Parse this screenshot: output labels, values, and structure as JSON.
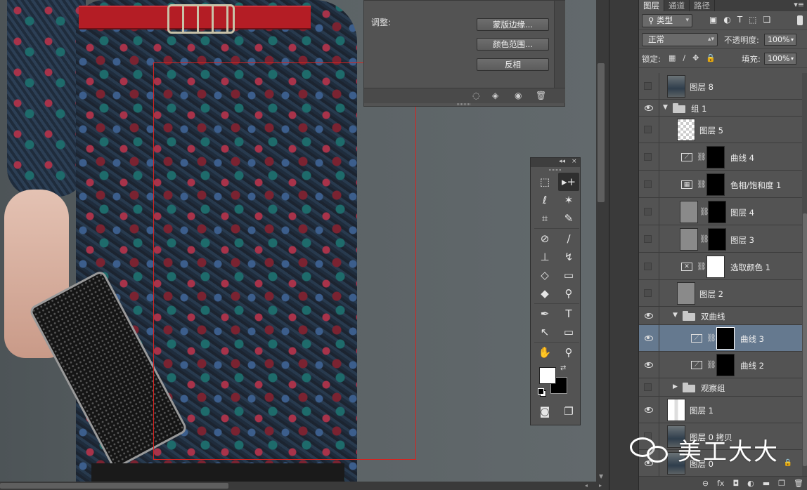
{
  "adjustments": {
    "section_label": "调整:",
    "buttons": [
      "蒙版边缘...",
      "颜色范围...",
      "反相"
    ],
    "footer_icons": [
      "◌",
      "◈",
      "◉",
      "🗑"
    ]
  },
  "layers_panel": {
    "tabs": [
      "图层",
      "通道",
      "路径"
    ],
    "filter_kind": "类型",
    "blend_mode": "正常",
    "opacity_label": "不透明度:",
    "opacity_value": "100%",
    "lock_label": "锁定:",
    "fill_label": "填充:",
    "fill_value": "100%",
    "layers": [
      {
        "name": "图层 8",
        "visible": false,
        "indent": 0,
        "kind": "photo"
      },
      {
        "name": "组 1",
        "visible": true,
        "indent": 0,
        "kind": "group",
        "expanded": true
      },
      {
        "name": "图层 5",
        "visible": false,
        "indent": 1,
        "kind": "transparent"
      },
      {
        "name": "曲线 4",
        "visible": false,
        "indent": 1,
        "kind": "curves"
      },
      {
        "name": "色相/饱和度 1",
        "visible": false,
        "indent": 1,
        "kind": "huesat"
      },
      {
        "name": "图层 4",
        "visible": false,
        "indent": 1,
        "kind": "masked-gray"
      },
      {
        "name": "图层 3",
        "visible": false,
        "indent": 1,
        "kind": "masked-gray"
      },
      {
        "name": "选取颜色 1",
        "visible": false,
        "indent": 1,
        "kind": "selective"
      },
      {
        "name": "图层 2",
        "visible": false,
        "indent": 1,
        "kind": "gray"
      },
      {
        "name": "双曲线",
        "visible": true,
        "indent": 1,
        "kind": "group",
        "expanded": true
      },
      {
        "name": "曲线 3",
        "visible": true,
        "indent": 2,
        "kind": "curves",
        "selected": true
      },
      {
        "name": "曲线 2",
        "visible": true,
        "indent": 2,
        "kind": "curves"
      },
      {
        "name": "观察组",
        "visible": false,
        "indent": 1,
        "kind": "group",
        "expanded": false
      },
      {
        "name": "图层 1",
        "visible": true,
        "indent": 0,
        "kind": "stripe"
      },
      {
        "name": "图层 0 拷贝",
        "visible": false,
        "indent": 0,
        "kind": "photo"
      },
      {
        "name": "图层 0",
        "visible": true,
        "indent": 0,
        "kind": "photo",
        "locked": true
      }
    ],
    "bottom_icons": [
      "⊖",
      "fx",
      "◘",
      "◐",
      "▬",
      "❐",
      "🗑"
    ]
  },
  "tools": [
    [
      "⬚",
      "▸+"
    ],
    [
      "ℓ",
      "✶"
    ],
    [
      "⌗",
      "✎"
    ],
    [
      "⊘",
      "∕"
    ],
    [
      "⊥",
      "↯"
    ],
    [
      "◇",
      "▭"
    ],
    [
      "◆",
      "⚲"
    ],
    [
      "✒",
      "T"
    ],
    [
      "↖",
      "▭"
    ],
    [
      "✋",
      "⚲"
    ]
  ],
  "toolbox_header": {
    "collapse": "◂◂",
    "close": "×"
  },
  "watermark": "美工大大",
  "colors": {
    "selection": "#d9231f",
    "selected_layer": "#65798f",
    "panel_bg": "#535353"
  }
}
